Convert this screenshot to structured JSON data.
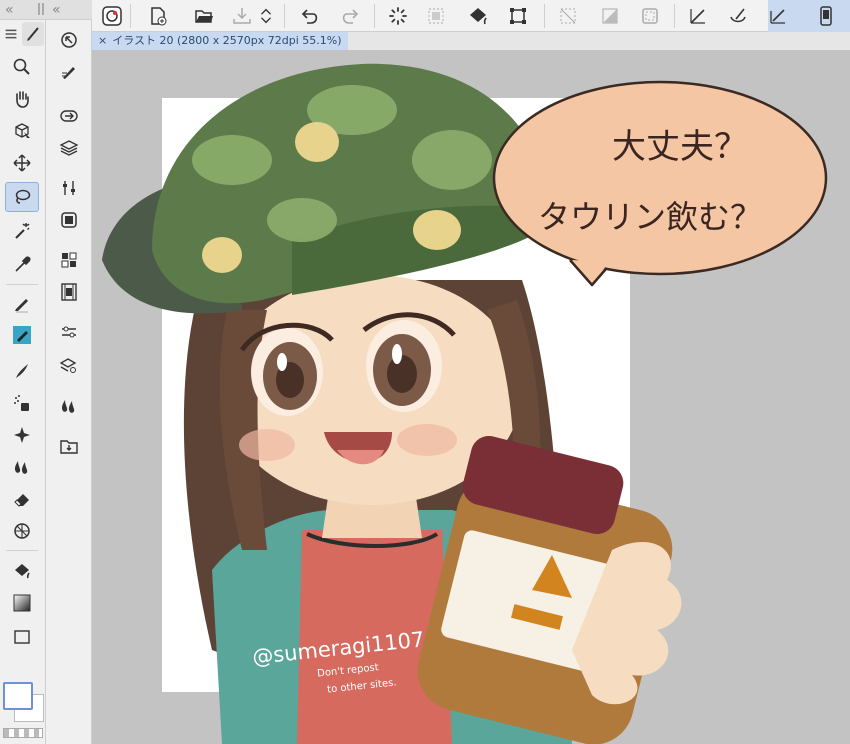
{
  "document_tab": {
    "close_glyph": "×",
    "title": "イラスト 20 (2800 x 2570px 72dpi 55.1%)"
  },
  "palette_header": {
    "left_arrows": "«",
    "right_arrows": "«"
  },
  "artwork": {
    "speech_line1": "大丈夫？",
    "speech_line2": "タウリン飲む？",
    "signature": "@sumeragi1107",
    "note_line1": "Don't repost",
    "note_line2": "to other sites."
  },
  "colors": {
    "accent": "#c9daf0",
    "canvas_bg": "#c3c3c3",
    "paper": "#ffffff",
    "speech_fill": "#f4c6a3"
  },
  "tools": [
    "ruler-icon",
    "zoom-icon",
    "hand-icon",
    "object-icon",
    "move-icon",
    "lasso-icon",
    "magic-wand-icon",
    "eyedropper-icon",
    "pen-icon",
    "pencil-icon",
    "brush-icon",
    "airbrush-icon",
    "decoration-icon",
    "blend-icon",
    "eraser-icon",
    "figure-icon",
    "fill-icon",
    "gradient-icon"
  ]
}
